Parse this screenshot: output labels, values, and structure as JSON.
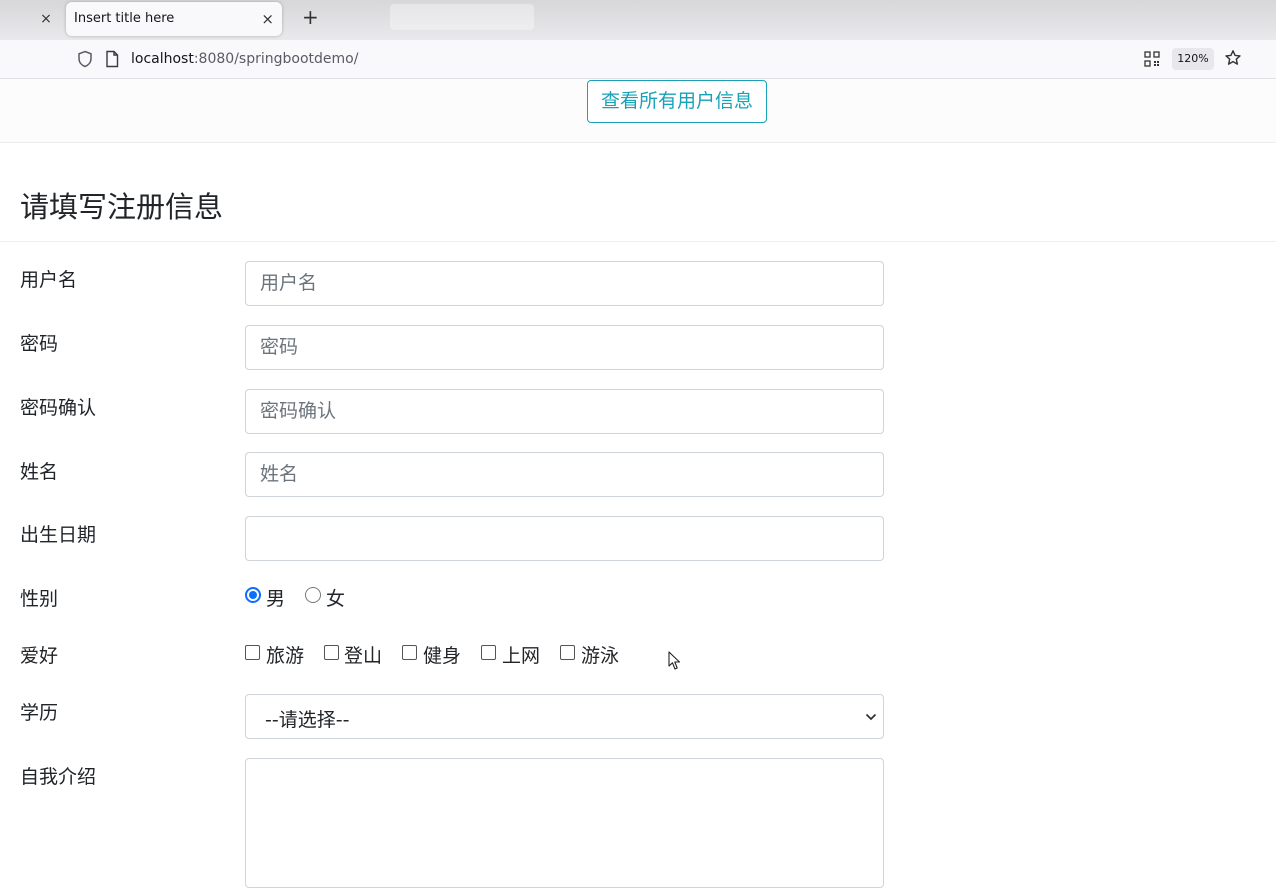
{
  "browser": {
    "tab_title": "Insert title here",
    "tab_close": "×",
    "prev_tab_close": "×",
    "new_tab": "+",
    "url_host": "localhost",
    "url_rest": ":8080/springbootdemo/",
    "zoom": "120%"
  },
  "page": {
    "view_all_button": "查看所有用户信息",
    "form_title": "请填写注册信息",
    "fields": {
      "username": {
        "label": "用户名",
        "placeholder": "用户名"
      },
      "password": {
        "label": "密码",
        "placeholder": "密码"
      },
      "password_confirm": {
        "label": "密码确认",
        "placeholder": "密码确认"
      },
      "name": {
        "label": "姓名",
        "placeholder": "姓名"
      },
      "birthdate": {
        "label": "出生日期",
        "value": ""
      },
      "gender": {
        "label": "性别",
        "options": [
          "男",
          "女"
        ],
        "selected": "男"
      },
      "hobbies": {
        "label": "爱好",
        "options": [
          "旅游",
          "登山",
          "健身",
          "上网",
          "游泳"
        ]
      },
      "education": {
        "label": "学历",
        "selected": "--请选择--"
      },
      "intro": {
        "label": "自我介绍"
      }
    }
  },
  "colors": {
    "accent": "#17a2b8",
    "radio": "#0d6efd"
  }
}
